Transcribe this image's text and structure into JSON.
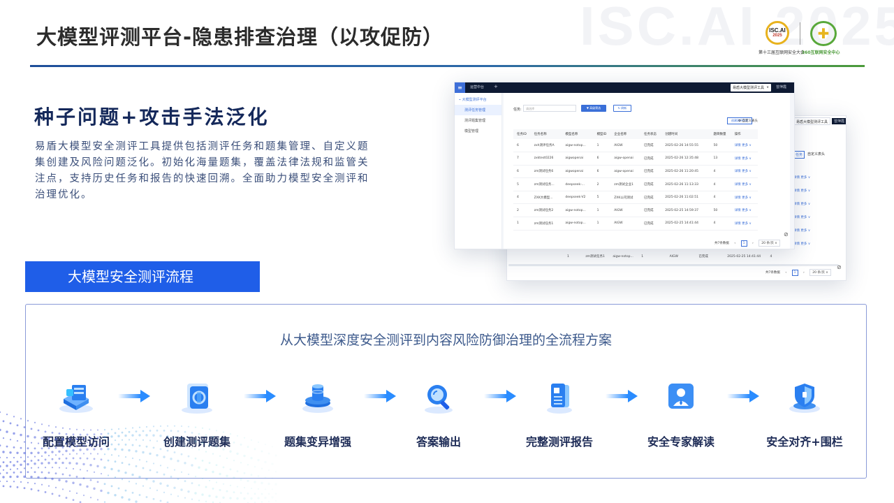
{
  "slide": {
    "title": "大模型评测平台-隐患排查治理（以攻促防）",
    "watermark": "ISC.AI 2025",
    "accent_color": "#1f5ee8",
    "rule_gradient": [
      "#1f4f9a",
      "#4c9b3a"
    ]
  },
  "logos": {
    "isc_text": "ISC.AI",
    "isc_year": "2025",
    "isc_caption": "第十三届互联网安全大会",
    "c360_caption": "360互联网安全中心"
  },
  "intro": {
    "heading": "种子问题+攻击手法泛化",
    "description": "易盾大模型安全测评工具提供包括测评任务和题集管理、自定义题集创建及风险问题泛化。初始化海量题集，覆盖法律法规和监管关注点，支持历史任务和报告的快速回溯。全面助力模型安全测评和治理优化。"
  },
  "mockup": {
    "topbar": {
      "menu_icon": "menu-icon",
      "tab_label": "运营中台",
      "plus": "+",
      "selector": "易盾大模型测评工具",
      "selector_chevron": "∨",
      "user": "曾萍霞"
    },
    "sidebar": {
      "group_label": "大模型测评平台",
      "items": [
        {
          "label": "测评任务管理",
          "active": true
        },
        {
          "label": "测评题集管理",
          "active": false
        },
        {
          "label": "模型管理",
          "active": false
        }
      ]
    },
    "filter": {
      "label": "任务:",
      "placeholder": "请选择",
      "search_button": "高级筛选",
      "reset_button": "刷新"
    },
    "actions": {
      "create_button": "创建测评任务",
      "columns_button": "自定义表头"
    },
    "table": {
      "columns": [
        "任务ID",
        "任务名称",
        "模型名称",
        "模型ID",
        "企业名称",
        "任务状态",
        "创建时间",
        "题目数量",
        "操作"
      ],
      "rows": [
        [
          "6",
          "zxh测评任务A",
          "aigw-notop...",
          "1",
          "AIGW",
          "已完成",
          "2025-02-26 14:55:55",
          "50",
          "详情  更多 ∨"
        ],
        [
          "7",
          "zxktest0226",
          "aigwopenai",
          "6",
          "aigw-openai",
          "已完成",
          "2025-02-26 12:35:48",
          "13",
          "详情  更多 ∨"
        ],
        [
          "6",
          "zm测试任务6",
          "aigwopenai",
          "6",
          "aigw-openai",
          "已完成",
          "2025-02-26 11:20:45",
          "4",
          "详情  更多 ∨"
        ],
        [
          "5",
          "zm测试任务...",
          "deepseek-...",
          "2",
          "zm测试企业1",
          "已完成",
          "2025-02-26 11:13:33",
          "4",
          "详情  更多 ∨"
        ],
        [
          "4",
          "ZXK大模型...",
          "deepseek-V2",
          "5",
          "ZXK公司测试",
          "已完成",
          "2025-02-26 11:02:51",
          "4",
          "详情  更多 ∨"
        ],
        [
          "2",
          "zm测试任务2",
          "aigw-notop...",
          "1",
          "AIGW",
          "已完成",
          "2025-02-25 14:59:37",
          "50",
          "详情  更多 ∨"
        ],
        [
          "1",
          "zm测试任务1",
          "aigw-notop...",
          "1",
          "AIGW",
          "已完成",
          "2025-02-25 14:41:44",
          "4",
          "详情  更多 ∨"
        ]
      ]
    },
    "pager": {
      "total": "共7条数据",
      "prev": "‹",
      "page": "1",
      "next": "›",
      "page_size": "20 条/页 ∨"
    },
    "back_window": {
      "selector": "易盾大模型测评工具",
      "user": "曾萍霞",
      "create_fragment": "任务",
      "columns_button": "自定义表头",
      "row_actions": "详情  更多 ∨",
      "last_row": [
        "1",
        "zm测试任务1",
        "aigw-notop...",
        "1",
        "AIGW",
        "已完成",
        "2025-02-25 14:41:44",
        "4"
      ],
      "pager": {
        "total": "共7条数据",
        "prev": "‹",
        "page": "1",
        "next": "›",
        "page_size": "20 条/页 ∨"
      }
    }
  },
  "process": {
    "tab_label": "大模型安全测评流程",
    "subtitle": "从大模型深度安全测评到内容风险防御治理的全流程方案",
    "steps": [
      {
        "label": "配置模型访问",
        "icon": "server-config-icon"
      },
      {
        "label": "创建测评题集",
        "icon": "question-set-icon"
      },
      {
        "label": "题集变异增强",
        "icon": "data-stack-icon"
      },
      {
        "label": "答案输出",
        "icon": "magnifier-output-icon"
      },
      {
        "label": "完整测评报告",
        "icon": "report-document-icon"
      },
      {
        "label": "安全专家解读",
        "icon": "expert-person-icon"
      },
      {
        "label": "安全对齐+围栏",
        "icon": "shield-guard-icon"
      }
    ]
  }
}
